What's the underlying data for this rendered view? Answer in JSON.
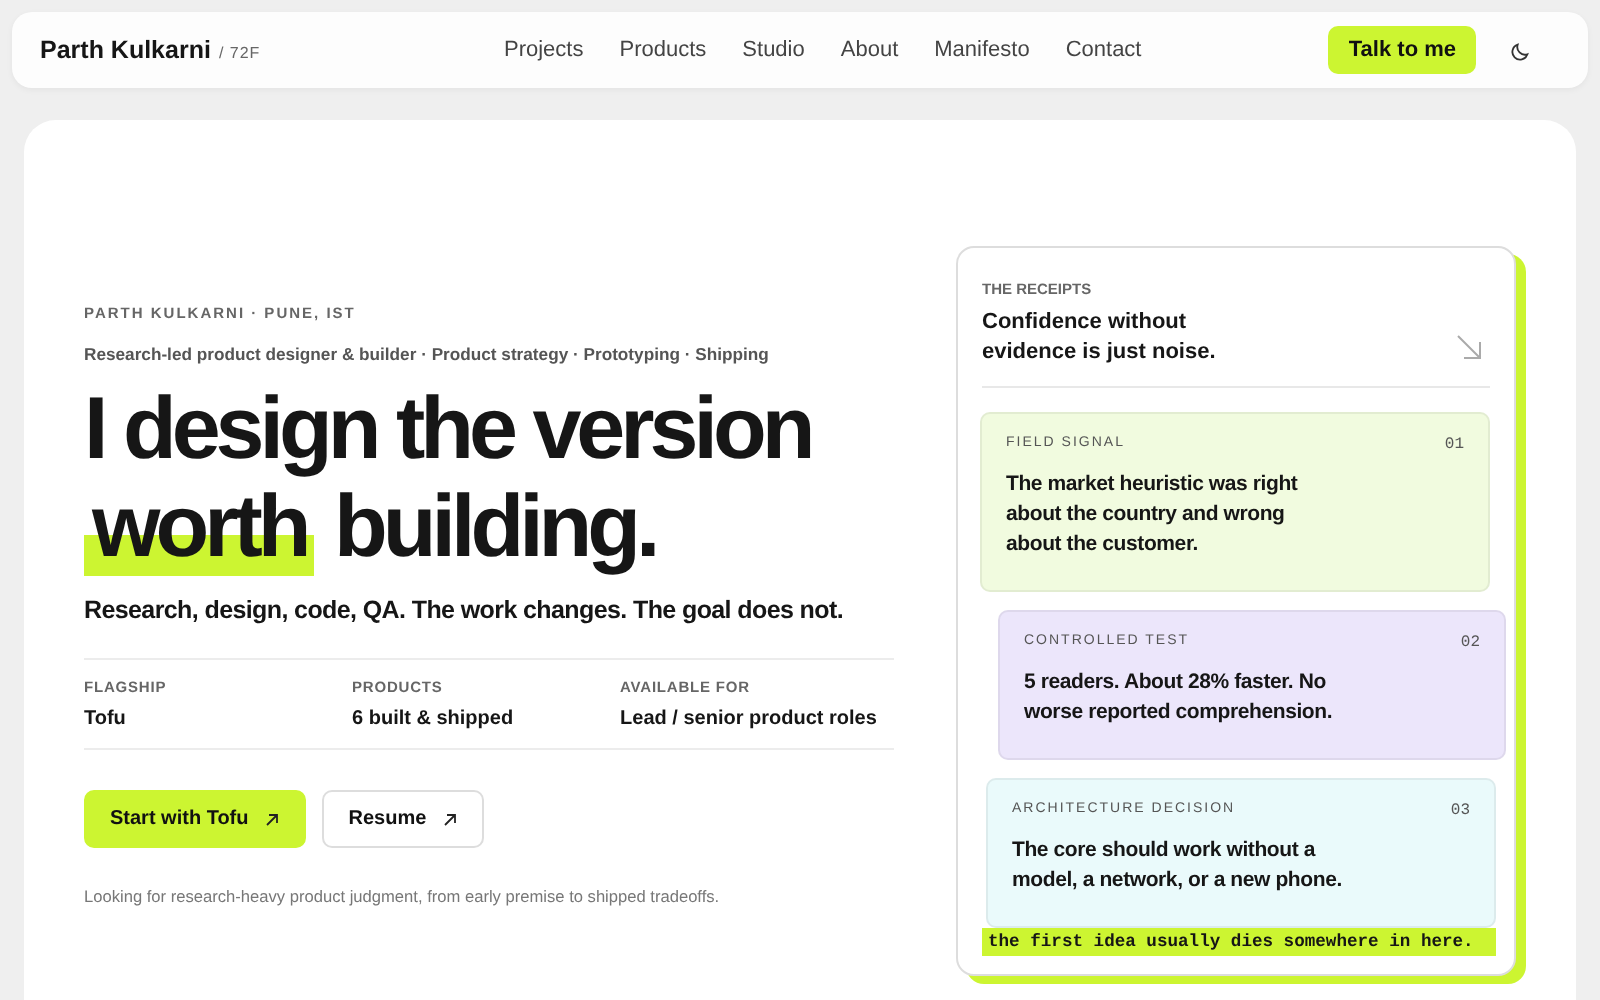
{
  "nav": {
    "brand": "Parth Kulkarni",
    "brand_suffix": "/ 72F",
    "links": [
      "Projects",
      "Products",
      "Studio",
      "About",
      "Manifesto",
      "Contact"
    ],
    "cta": "Talk to me"
  },
  "hero": {
    "eyebrow": "PARTH KULKARNI · PUNE, IST",
    "roles": "Research-led product designer & builder · Product strategy · Prototyping · Shipping",
    "headline": {
      "before": "I design the version",
      "highlight": "worth",
      "after": "building."
    },
    "subhead": "Research, design, code, QA. The work changes. The goal does not.",
    "stats": [
      {
        "label": "FLAGSHIP",
        "value": "Tofu"
      },
      {
        "label": "PRODUCTS",
        "value": "6 built & shipped"
      },
      {
        "label": "AVAILABLE FOR",
        "value": "Lead / senior product roles"
      }
    ],
    "buttons": [
      {
        "kind": "primary",
        "label": "Start with Tofu"
      },
      {
        "kind": "secondary",
        "label": "Resume"
      }
    ],
    "note": "Looking for research-heavy product judgment, from early premise to shipped tradeoffs."
  },
  "receipts": {
    "eyebrow": "THE RECEIPTS",
    "title": "Confidence without evidence is just noise.",
    "items": [
      {
        "label": "FIELD SIGNAL",
        "number": "01",
        "text": "The market heuristic was right about the country and wrong about the customer.",
        "color": "#f1fbdf"
      },
      {
        "label": "CONTROLLED TEST",
        "number": "02",
        "text": "5 readers. About 28% faster. No worse reported comprehension.",
        "color": "#ece6fb"
      },
      {
        "label": "ARCHITECTURE DECISION",
        "number": "03",
        "text": "The core should work without a model, a network, or a new phone.",
        "color": "#eafafb"
      }
    ],
    "footnote": "the first idea usually dies somewhere in here."
  }
}
